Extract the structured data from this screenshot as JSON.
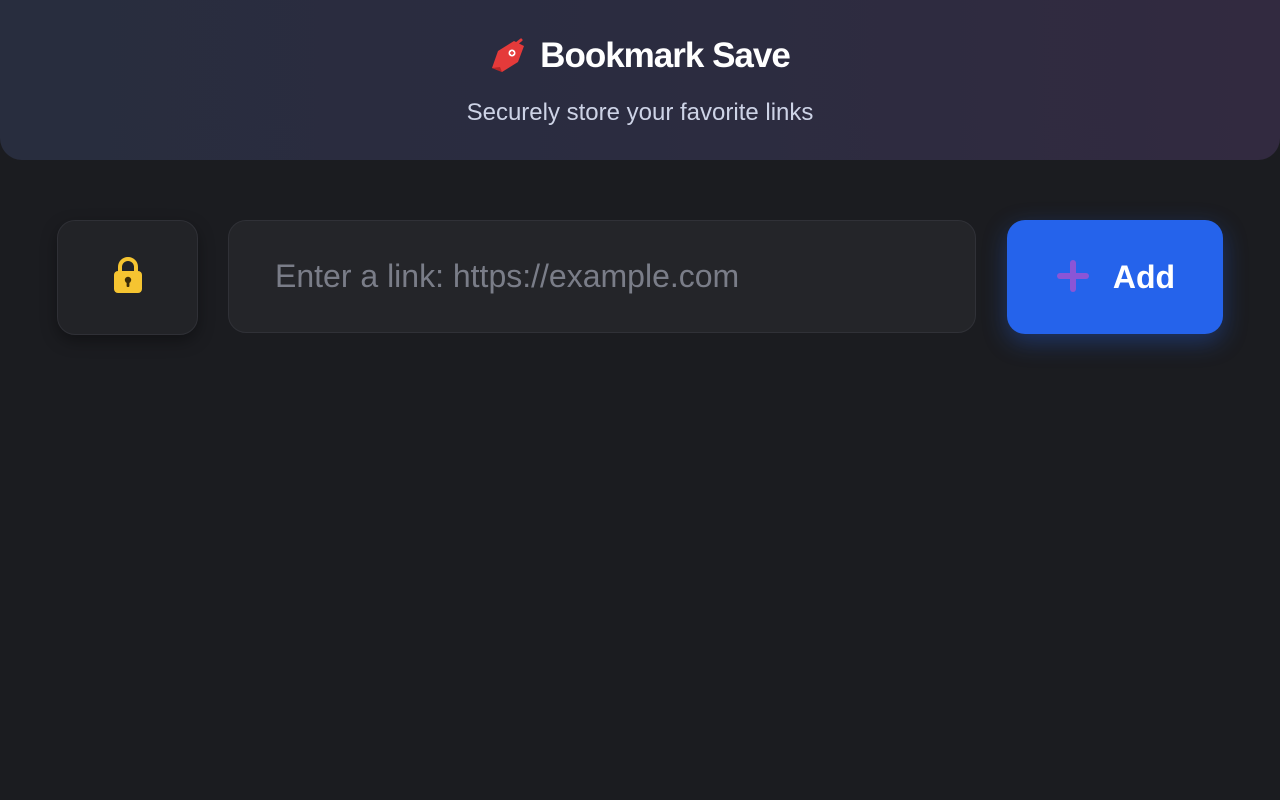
{
  "header": {
    "title": "Bookmark Save",
    "subtitle": "Securely store your favorite links",
    "title_icon": "bookmark-tag-icon",
    "gradient_start": "#282d3e",
    "gradient_end": "#322a40"
  },
  "lock": {
    "icon": "lock-icon",
    "color": "#f5c431"
  },
  "link_input": {
    "value": "",
    "placeholder": "Enter a link: https://example.com"
  },
  "add_button": {
    "label": "Add",
    "icon": "plus-icon",
    "background": "#2563eb",
    "icon_color": "#8b55d6"
  },
  "colors": {
    "background": "#1b1c20",
    "accent_red": "#e53a3a"
  }
}
